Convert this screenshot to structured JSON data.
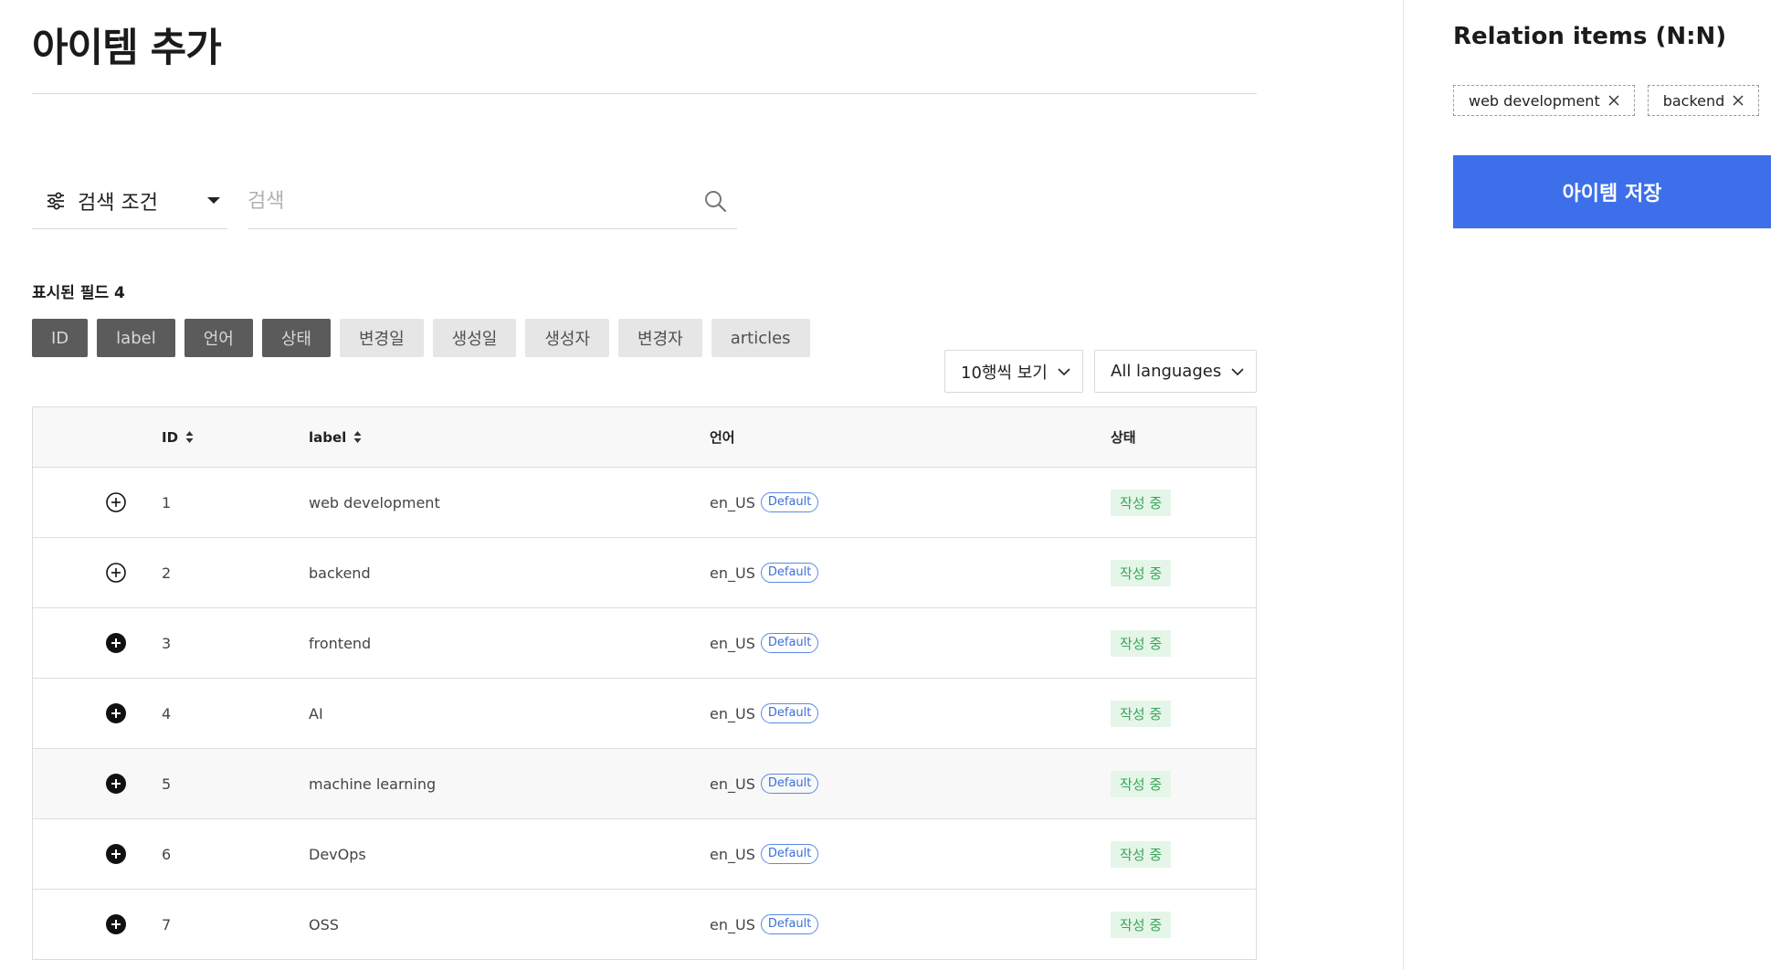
{
  "page": {
    "title": "아이템 추가"
  },
  "filter": {
    "label": "검색 조건",
    "icon": "sliders-icon"
  },
  "search": {
    "placeholder": "검색",
    "icon": "search-icon"
  },
  "fields": {
    "heading": "표시된 필드 4",
    "chips": [
      {
        "label": "ID",
        "active": true
      },
      {
        "label": "label",
        "active": true
      },
      {
        "label": "언어",
        "active": true
      },
      {
        "label": "상태",
        "active": true
      },
      {
        "label": "변경일",
        "active": false
      },
      {
        "label": "생성일",
        "active": false
      },
      {
        "label": "생성자",
        "active": false
      },
      {
        "label": "변경자",
        "active": false
      },
      {
        "label": "articles",
        "active": false
      }
    ]
  },
  "controls": {
    "rows_per_page": "10행씩 보기",
    "language": "All languages"
  },
  "table": {
    "headers": {
      "id": "ID",
      "label": "label",
      "lang": "언어",
      "status": "상태"
    },
    "rows": [
      {
        "id": "1",
        "label": "web development",
        "lang": "en_US",
        "badge": "Default",
        "status": "작성 중",
        "added": true
      },
      {
        "id": "2",
        "label": "backend",
        "lang": "en_US",
        "badge": "Default",
        "status": "작성 중",
        "added": true
      },
      {
        "id": "3",
        "label": "frontend",
        "lang": "en_US",
        "badge": "Default",
        "status": "작성 중",
        "added": false
      },
      {
        "id": "4",
        "label": "AI",
        "lang": "en_US",
        "badge": "Default",
        "status": "작성 중",
        "added": false
      },
      {
        "id": "5",
        "label": "machine learning",
        "lang": "en_US",
        "badge": "Default",
        "status": "작성 중",
        "added": false
      },
      {
        "id": "6",
        "label": "DevOps",
        "lang": "en_US",
        "badge": "Default",
        "status": "작성 중",
        "added": false
      },
      {
        "id": "7",
        "label": "OSS",
        "lang": "en_US",
        "badge": "Default",
        "status": "작성 중",
        "added": false
      }
    ]
  },
  "sidebar": {
    "title": "Relation items (N:N)",
    "tags": [
      {
        "label": "web development"
      },
      {
        "label": "backend"
      }
    ],
    "save_label": "아이템 저장"
  },
  "colors": {
    "accent": "#3e6fea",
    "chip_active_bg": "#5b5b5b",
    "chip_inactive_bg": "#e6e6e6",
    "status_bg": "#e5f6e9",
    "status_text": "#3aa55a",
    "badge_blue": "#3b6fd6"
  }
}
